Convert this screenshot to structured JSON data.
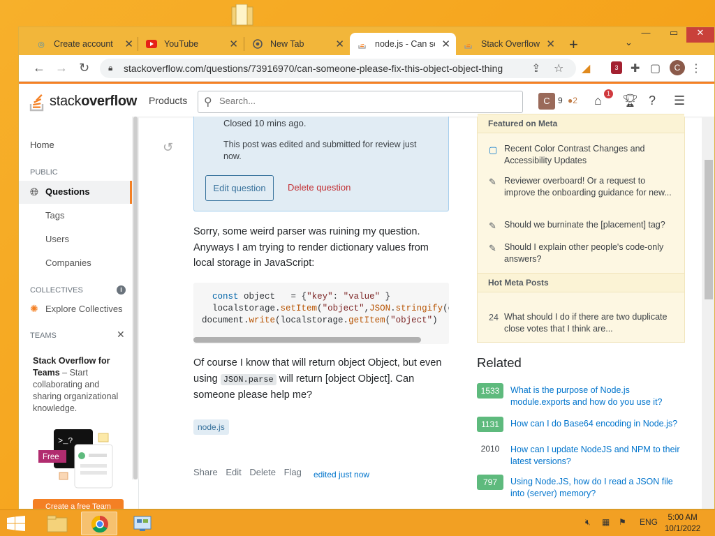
{
  "browser": {
    "tabs": [
      {
        "label": "Create account · ",
        "icon": "account-tab-icon"
      },
      {
        "label": "YouTube",
        "icon": "youtube-icon"
      },
      {
        "label": "New Tab",
        "icon": "chrome-icon"
      },
      {
        "label": "node.js - Can so",
        "icon": "stackoverflow-icon"
      },
      {
        "label": "Stack Overflow · ",
        "icon": "stackoverflow-icon"
      }
    ],
    "url": "stackoverflow.com/questions/73916970/can-someone-please-fix-this-object-object-thing",
    "profile_initial": "C",
    "ext_badge": "3"
  },
  "so": {
    "logo_word_light": "stack",
    "logo_word_bold": "overflow",
    "products": "Products",
    "search_placeholder": "Search...",
    "user_initial": "C",
    "reputation": "9",
    "bronze": "●2",
    "inbox_count": "1"
  },
  "leftnav": {
    "home": "Home",
    "public": "PUBLIC",
    "questions": "Questions",
    "tags": "Tags",
    "users": "Users",
    "companies": "Companies",
    "collectives": "COLLECTIVES",
    "explore": "Explore Collectives",
    "teams": "TEAMS",
    "teams_title": "Stack Overflow for Teams",
    "teams_desc": " – Start collaborating and sharing organizational knowledge.",
    "free": "Free",
    "create_team": "Create a free Team"
  },
  "post": {
    "closed_text": "Closed 10 mins ago.",
    "edited_notice": "This post was edited and submitted for review just now.",
    "edit_question": "Edit question",
    "delete_question": "Delete question",
    "para1": "Sorry, some weird parser was ruining my question. Anyways I am trying to render dictionary values from local storage in JavaScript:",
    "para2_a": "Of course I know that will return object Object, but even using ",
    "para2_code": "JSON.parse",
    "para2_b": " will return [object Object]. Can someone please help me?",
    "tag": "node.js",
    "share": "Share",
    "edit": "Edit",
    "delete": "Delete",
    "flag": "Flag",
    "edited": "edited just now"
  },
  "meta": {
    "featured_title": "Featured on Meta",
    "featured": [
      "Recent Color Contrast Changes and Accessibility Updates",
      "Reviewer overboard! Or a request to improve the onboarding guidance for new...",
      "Should we burninate the [placement] tag?",
      "Should I explain other people's code-only answers?"
    ],
    "hot_title": "Hot Meta Posts",
    "hot_score": "24",
    "hot_text": "What should I do if there are two duplicate close votes that I think are..."
  },
  "related": {
    "title": "Related",
    "items": [
      {
        "score": "1533",
        "text": "What is the purpose of Node.js module.exports and how do you use it?",
        "accepted": true
      },
      {
        "score": "1131",
        "text": "How can I do Base64 encoding in Node.js?",
        "accepted": true
      },
      {
        "score": "2010",
        "text": "How can I update NodeJS and NPM to their latest versions?",
        "accepted": false
      },
      {
        "score": "797",
        "text": "Using Node.JS, how do I read a JSON file into (server) memory?",
        "accepted": true
      }
    ]
  },
  "taskbar": {
    "lang": "ENG",
    "time": "5:00 AM",
    "date": "10/1/2022"
  },
  "colors": {
    "accent": "#f48024",
    "link": "#0074cc",
    "accepted": "#5eba7d"
  }
}
